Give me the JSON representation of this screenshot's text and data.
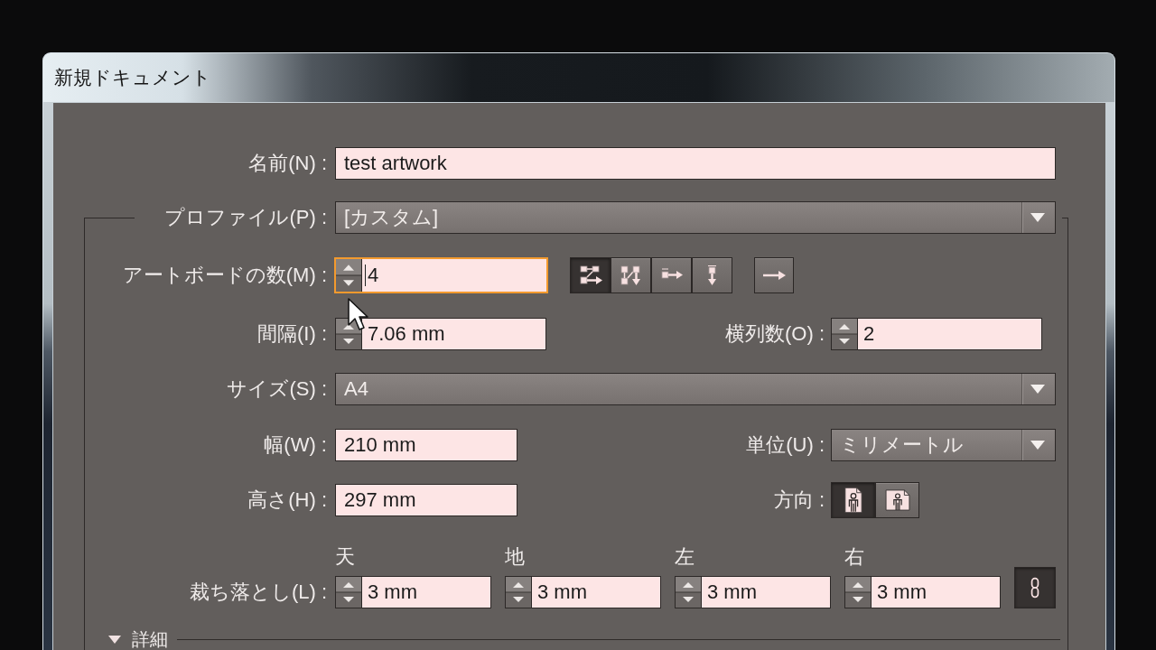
{
  "window": {
    "title": "新規ドキュメント"
  },
  "name": {
    "label": "名前(N) :",
    "value": "test artwork"
  },
  "profile": {
    "label": "プロファイル(P) :",
    "value": "[カスタム]"
  },
  "artboards": {
    "label": "アートボードの数(M) :",
    "value": "4",
    "focused": true,
    "arrangements": [
      {
        "kind": "grid-by-row",
        "selected": true
      },
      {
        "kind": "grid-by-column",
        "selected": false
      },
      {
        "kind": "row",
        "selected": false
      },
      {
        "kind": "column",
        "selected": false
      }
    ]
  },
  "spacing": {
    "label": "間隔(I) :",
    "value": "7.06 mm"
  },
  "columns": {
    "label": "横列数(O) :",
    "value": "2"
  },
  "size": {
    "label": "サイズ(S) :",
    "value": "A4"
  },
  "width": {
    "label": "幅(W) :",
    "value": "210 mm"
  },
  "units": {
    "label": "単位(U) :",
    "value": "ミリメートル"
  },
  "height": {
    "label": "高さ(H) :",
    "value": "297 mm"
  },
  "orientation": {
    "label": "方向 :",
    "options": [
      {
        "kind": "portrait",
        "selected": true
      },
      {
        "kind": "landscape",
        "selected": false
      }
    ]
  },
  "bleed": {
    "label": "裁ち落とし(L) :",
    "linked": true,
    "sides": [
      {
        "label": "天",
        "value": "3 mm"
      },
      {
        "label": "地",
        "value": "3 mm"
      },
      {
        "label": "左",
        "value": "3 mm"
      },
      {
        "label": "右",
        "value": "3 mm"
      }
    ]
  },
  "advanced": {
    "label": "詳細",
    "expanded": true
  }
}
